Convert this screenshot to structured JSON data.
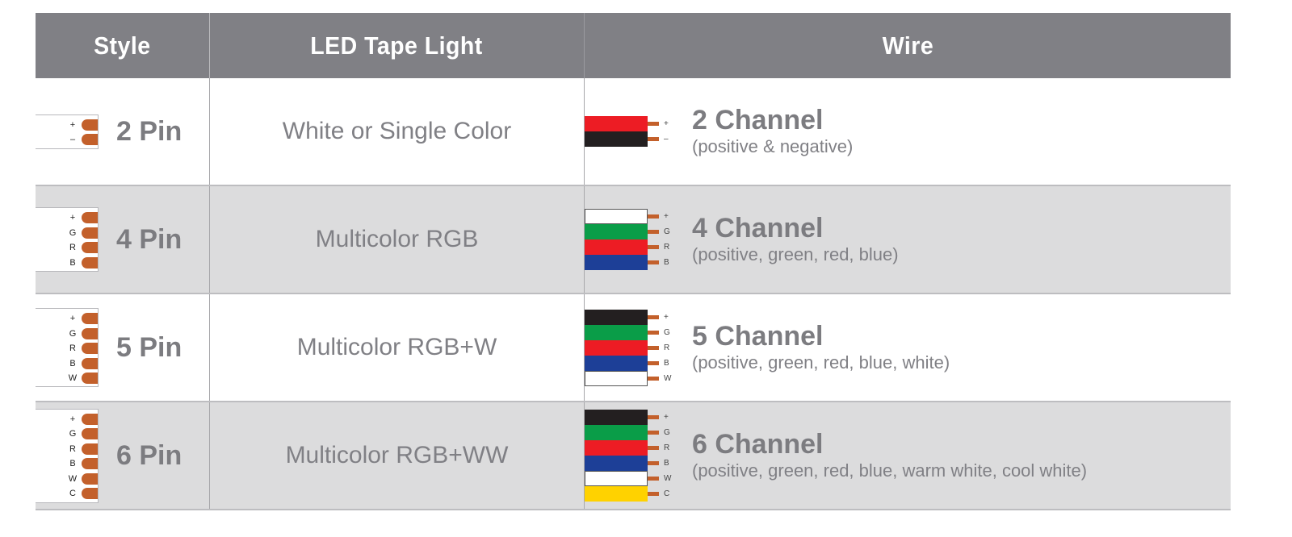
{
  "header": {
    "style": "Style",
    "led": "LED Tape Light",
    "wire": "Wire"
  },
  "colors": {
    "header_bg": "#808085",
    "alt_row_bg": "#dcdcdd",
    "pad": "#c3602b",
    "red": "#ed1c24",
    "black": "#231f20",
    "green": "#0a9d48",
    "blue": "#1d3f97",
    "white": "#ffffff",
    "yellow": "#ffd200"
  },
  "rows": [
    {
      "pin": "2 Pin",
      "led": "White or Single Color",
      "pads": [
        "+",
        "–"
      ],
      "channel": "2 Channel",
      "desc": "(positive & negative)",
      "wires": [
        {
          "color": "red",
          "label": "+"
        },
        {
          "color": "black",
          "label": "–"
        }
      ]
    },
    {
      "pin": "4 Pin",
      "led": "Multicolor RGB",
      "pads": [
        "+",
        "G",
        "R",
        "B"
      ],
      "channel": "4 Channel",
      "desc": "(positive, green, red, blue)",
      "wires": [
        {
          "color": "white",
          "label": "+"
        },
        {
          "color": "green",
          "label": "G"
        },
        {
          "color": "red",
          "label": "R"
        },
        {
          "color": "blue",
          "label": "B"
        }
      ]
    },
    {
      "pin": "5 Pin",
      "led": "Multicolor RGB+W",
      "pads": [
        "+",
        "G",
        "R",
        "B",
        "W"
      ],
      "channel": "5 Channel",
      "desc": "(positive, green, red, blue, white)",
      "wires": [
        {
          "color": "black",
          "label": "+"
        },
        {
          "color": "green",
          "label": "G"
        },
        {
          "color": "red",
          "label": "R"
        },
        {
          "color": "blue",
          "label": "B"
        },
        {
          "color": "white",
          "label": "W"
        }
      ]
    },
    {
      "pin": "6 Pin",
      "led": "Multicolor RGB+WW",
      "pads": [
        "+",
        "G",
        "R",
        "B",
        "W",
        "C"
      ],
      "channel": "6 Channel",
      "desc": "(positive, green, red, blue, warm white, cool white)",
      "wires": [
        {
          "color": "black",
          "label": "+"
        },
        {
          "color": "green",
          "label": "G"
        },
        {
          "color": "red",
          "label": "R"
        },
        {
          "color": "blue",
          "label": "B"
        },
        {
          "color": "white",
          "label": "W"
        },
        {
          "color": "yellow",
          "label": "C"
        }
      ]
    }
  ]
}
